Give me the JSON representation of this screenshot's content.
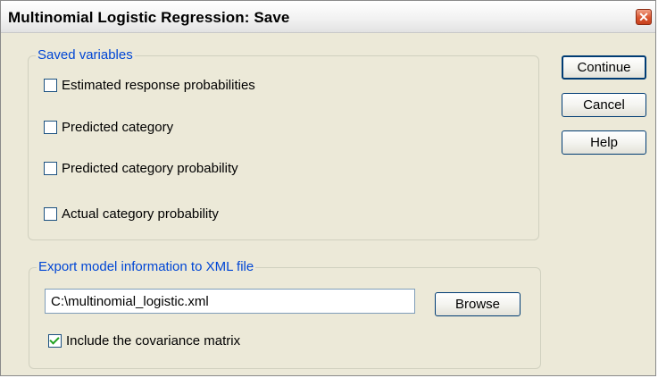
{
  "window": {
    "title": "Multinomial Logistic Regression: Save",
    "close_glyph": "✕"
  },
  "saved_variables": {
    "legend": "Saved variables",
    "items": [
      {
        "label": "Estimated response probabilities",
        "checked": false
      },
      {
        "label": "Predicted category",
        "checked": false
      },
      {
        "label": "Predicted category probability",
        "checked": false
      },
      {
        "label": "Actual category probability",
        "checked": false
      }
    ]
  },
  "export": {
    "legend": "Export model information to XML file",
    "file_path": "C:\\multinomial_logistic.xml",
    "browse_label": "Browse",
    "include_covariance_label": "Include the covariance matrix",
    "include_covariance_checked": true
  },
  "buttons": {
    "continue_label": "Continue",
    "cancel_label": "Cancel",
    "help_label": "Help"
  },
  "colors": {
    "legend_text": "#0046d5",
    "dialog_bg": "#ece9d8",
    "close_button": "#d9552f",
    "checkmark": "#21a121"
  }
}
